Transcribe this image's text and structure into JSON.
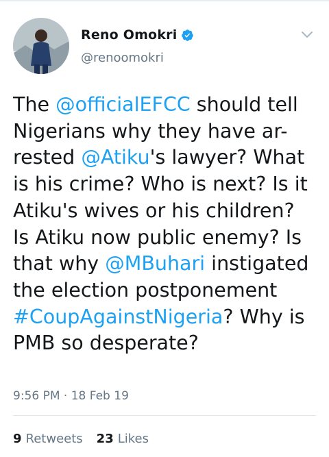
{
  "tweet": {
    "author": {
      "display_name": "Reno Omokri",
      "handle": "@renoomokri",
      "verified": true
    },
    "text_lines": [
      [
        {
          "t": "The ",
          "link": false
        },
        {
          "t": "@officialEFCC",
          "link": true
        },
        {
          "t": " should tell",
          "link": false
        }
      ],
      [
        {
          "t": "Nigerians why they have ar-",
          "link": false
        }
      ],
      [
        {
          "t": "rested ",
          "link": false
        },
        {
          "t": "@Atiku",
          "link": true
        },
        {
          "t": "'s lawyer? What",
          "link": false
        }
      ],
      [
        {
          "t": "is his crime? Who is next? Is it",
          "link": false
        }
      ],
      [
        {
          "t": "Atiku's wives or his children?",
          "link": false
        }
      ],
      [
        {
          "t": "Is Atiku now public enemy? Is",
          "link": false
        }
      ],
      [
        {
          "t": "that why ",
          "link": false
        },
        {
          "t": "@MBuhari",
          "link": true
        },
        {
          "t": " instigated",
          "link": false
        }
      ],
      [
        {
          "t": "the election postponement",
          "link": false
        }
      ],
      [
        {
          "t": "#CoupAgainstNigeria",
          "link": true
        },
        {
          "t": "? Why is",
          "link": false
        }
      ],
      [
        {
          "t": "PMB so desperate?",
          "link": false
        }
      ]
    ],
    "time": "9:56 PM",
    "separator": "·",
    "date": "18 Feb 19",
    "retweets": {
      "count": "9",
      "label": "Retweets"
    },
    "likes": {
      "count": "23",
      "label": "Likes"
    }
  },
  "colors": {
    "link": "#1da1f2",
    "text": "#14171a",
    "muted": "#657786",
    "verified": "#1da1f2"
  }
}
